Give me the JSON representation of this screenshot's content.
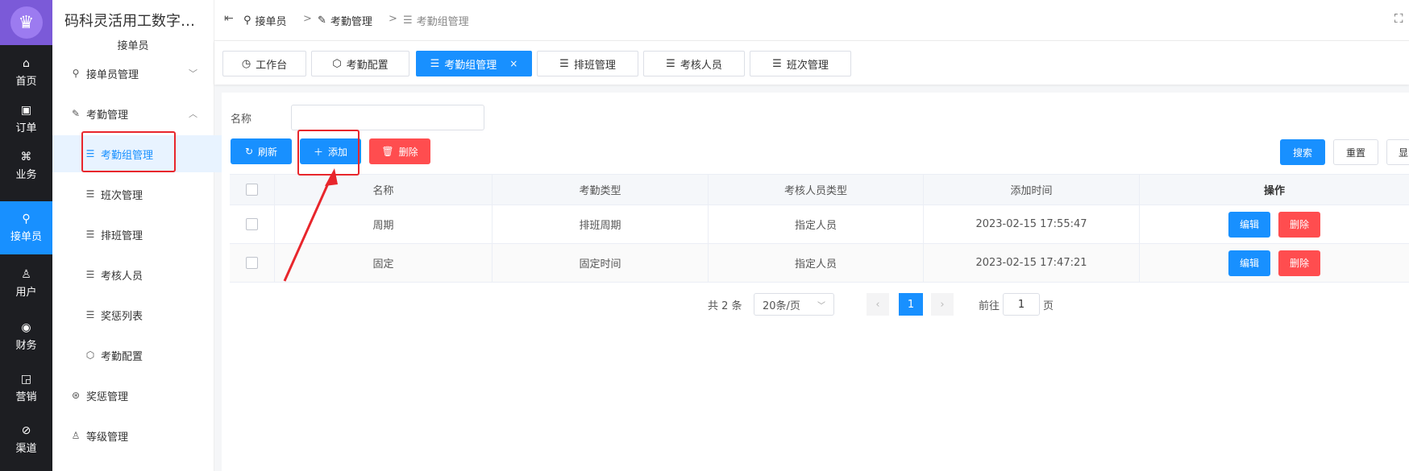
{
  "app": {
    "title": "码科灵活用工数字…",
    "subtitle": "接单员"
  },
  "rail": [
    {
      "icon": "home-icon",
      "glyph": "⌂",
      "label": "首页"
    },
    {
      "icon": "order-icon",
      "glyph": "▣",
      "label": "订单"
    },
    {
      "icon": "business-icon",
      "glyph": "⌘",
      "label": "业务"
    },
    {
      "icon": "rider-icon",
      "glyph": "⚲",
      "label": "接单员"
    },
    {
      "icon": "user-icon",
      "glyph": "♙",
      "label": "用户"
    },
    {
      "icon": "finance-icon",
      "glyph": "◉",
      "label": "财务"
    },
    {
      "icon": "marketing-icon",
      "glyph": "◲",
      "label": "营销"
    },
    {
      "icon": "channel-icon",
      "glyph": "⊘",
      "label": "渠道"
    }
  ],
  "sidebar": {
    "items": [
      {
        "label": "接单员管理",
        "icon": "bike-icon"
      },
      {
        "label": "考勤管理",
        "icon": "edit-icon"
      },
      {
        "label": "考勤组管理",
        "icon": "list-icon"
      },
      {
        "label": "班次管理",
        "icon": "list-icon"
      },
      {
        "label": "排班管理",
        "icon": "list-icon"
      },
      {
        "label": "考核人员",
        "icon": "list-icon"
      },
      {
        "label": "奖惩列表",
        "icon": "list-icon"
      },
      {
        "label": "考勤配置",
        "icon": "hexagon-icon"
      },
      {
        "label": "奖惩管理",
        "icon": "medal-icon"
      },
      {
        "label": "等级管理",
        "icon": "user-level-icon"
      }
    ]
  },
  "breadcrumb": [
    "接单员",
    "考勤管理",
    "考勤组管理"
  ],
  "tabs": [
    {
      "label": "工作台"
    },
    {
      "label": "考勤配置"
    },
    {
      "label": "考勤组管理",
      "close": "×"
    },
    {
      "label": "排班管理"
    },
    {
      "label": "考核人员"
    },
    {
      "label": "班次管理"
    }
  ],
  "filter": {
    "name_label": "名称",
    "name_value": ""
  },
  "toolbar": {
    "refresh": "刷新",
    "add": "添加",
    "delete": "删除",
    "search": "搜索",
    "reset": "重置",
    "show": "显"
  },
  "table": {
    "headers": [
      "名称",
      "考勤类型",
      "考核人员类型",
      "添加时间",
      "操作"
    ],
    "rows": [
      {
        "name": "周期",
        "type": "排班周期",
        "person_type": "指定人员",
        "time": "2023-02-15 17:55:47",
        "edit": "编辑",
        "del": "删除"
      },
      {
        "name": "固定",
        "type": "固定时间",
        "person_type": "指定人员",
        "time": "2023-02-15 17:47:21",
        "edit": "编辑",
        "del": "删除"
      }
    ]
  },
  "pagination": {
    "total": "共 2 条",
    "page_size": "20条/页",
    "current": "1",
    "goto_label": "前往",
    "goto_value": "1",
    "page_unit": "页"
  },
  "colors": {
    "primary": "#1890ff",
    "danger": "#ff4d4f",
    "rail": "#1d1e22",
    "annotation": "#e8262c"
  }
}
